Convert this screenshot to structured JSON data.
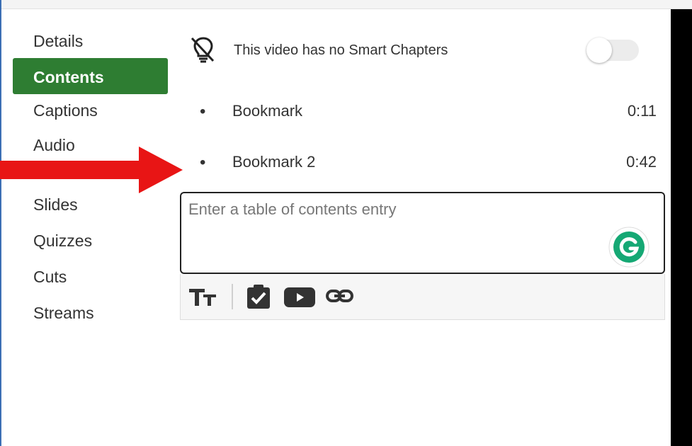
{
  "sidebar": {
    "items": [
      {
        "label": "Details"
      },
      {
        "label": "Contents",
        "active": true
      },
      {
        "label": "Captions"
      },
      {
        "label": "Audio Descriptions"
      },
      {
        "label": "Slides"
      },
      {
        "label": "Quizzes"
      },
      {
        "label": "Cuts"
      },
      {
        "label": "Streams"
      }
    ]
  },
  "smart_chapters": {
    "text": "This video has no Smart Chapters",
    "icon": "lightbulb-off-icon",
    "toggle_on": false
  },
  "bookmarks": [
    {
      "label": "Bookmark",
      "time": "0:11"
    },
    {
      "label": "Bookmark 2",
      "time": "0:42"
    }
  ],
  "entry": {
    "placeholder": "Enter a table of contents entry",
    "value": ""
  },
  "toolbar": {
    "icons": [
      "text-size-icon",
      "clipboard-check-icon",
      "youtube-icon",
      "link-icon"
    ]
  },
  "colors": {
    "accent": "#2e7d32",
    "arrow": "#e81515",
    "grammarly": "#15a874"
  }
}
